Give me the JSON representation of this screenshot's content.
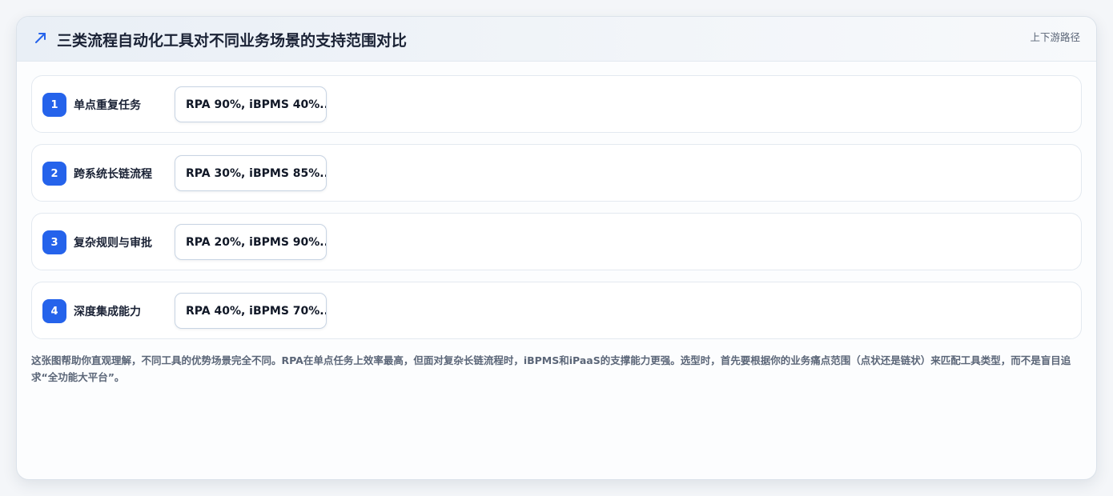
{
  "header": {
    "title": "三类流程自动化工具对不同业务场景的支持范围对比",
    "link_label": "上下游路径",
    "icon": "trend-arrow-icon"
  },
  "rows": [
    {
      "index": "1",
      "label": "单点重复任务",
      "value": "RPA 90%, iBPMS 40%..."
    },
    {
      "index": "2",
      "label": "跨系统长链流程",
      "value": "RPA 30%, iBPMS 85%..."
    },
    {
      "index": "3",
      "label": "复杂规则与审批",
      "value": "RPA 20%, iBPMS 90%..."
    },
    {
      "index": "4",
      "label": "深度集成能力",
      "value": "RPA 40%, iBPMS 70%..."
    }
  ],
  "note": "这张图帮助你直观理解，不同工具的优势场景完全不同。RPA在单点任务上效率最高，但面对复杂长链流程时，iBPMS和iPaaS的支撑能力更强。选型时，首先要根据你的业务痛点范围（点状还是链状）来匹配工具类型，而不是盲目追求“全功能大平台”。",
  "colors": {
    "accent": "#2563eb",
    "title": "#1a2235",
    "muted": "#5b6678"
  }
}
